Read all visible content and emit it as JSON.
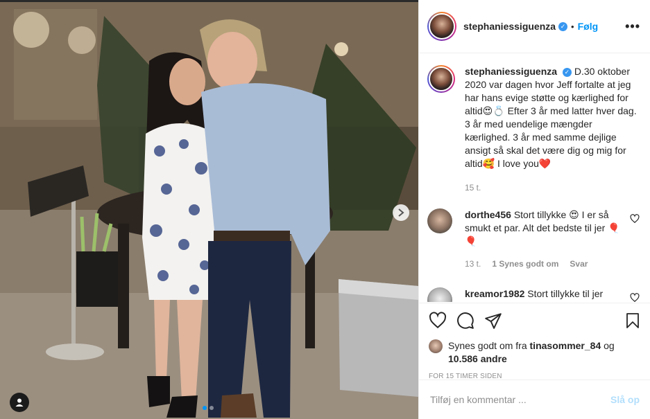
{
  "post": {
    "username": "stephaniessiguenza",
    "follow_label": "Følg",
    "separator": "•",
    "verified_icon": "verified-badge-icon",
    "more_icon": "more-options-icon"
  },
  "caption": {
    "username": "stephaniessiguenza",
    "text": "D.30 oktober 2020 var dagen hvor Jeff fortalte at jeg har hans evige støtte og kærlighed for altid😍💍 Efter 3 år med latter hver dag. 3 år med uendelige mængder kærlighed. 3 år med samme dejlige ansigt så skal det være dig og mig for altid🥰 I love you❤️",
    "time": "15 t."
  },
  "comments": [
    {
      "username": "dorthe456",
      "text": "Stort tillykke 😍 I er så smukt et par. Alt det bedste til jer 🎈🎈",
      "time": "13 t.",
      "likes": "1 Synes godt om",
      "reply": "Svar"
    },
    {
      "username": "kreamor1982",
      "text": "Stort tillykke til jer"
    }
  ],
  "likes": {
    "prefix": "Synes godt om fra",
    "user": "tinasommer_84",
    "conj": "og",
    "others": "10.586 andre"
  },
  "timestamp": "FOR 15 TIMER SIDEN",
  "add_comment": {
    "placeholder": "Tilføj en kommentar ...",
    "post_label": "Slå op"
  },
  "carousel": {
    "slides": 2,
    "active": 1
  },
  "colors": {
    "accent": "#0095f6",
    "post_disabled": "#b2dffc",
    "heart_red": "#ed4956"
  },
  "icons": [
    "heart-icon",
    "comment-icon",
    "share-icon",
    "save-icon",
    "next-arrow-icon",
    "user-tag-icon"
  ]
}
